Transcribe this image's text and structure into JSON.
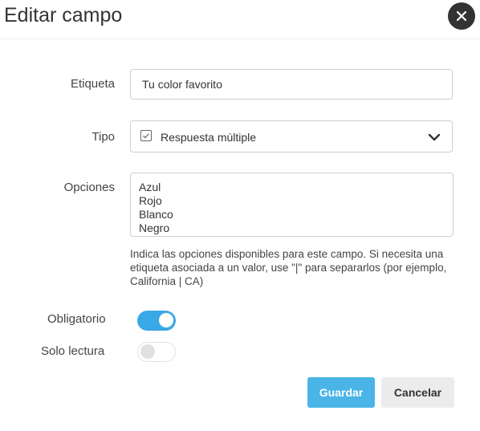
{
  "dialog": {
    "title": "Editar campo",
    "close_icon": "close-icon"
  },
  "form": {
    "etiqueta": {
      "label": "Etiqueta",
      "value": "Tu color favorito"
    },
    "tipo": {
      "label": "Tipo",
      "value": "Respuesta múltiple",
      "icon": "checkbox-icon",
      "dropdown_icon": "chevron-down-icon"
    },
    "opciones": {
      "label": "Opciones",
      "value": "Azul\nRojo\nBlanco\nNegro",
      "help": "Indica las opciones disponibles para este campo. Si necesita una etiqueta asociada a un valor, use \"|\" para separarlos (por ejemplo, California | CA)"
    },
    "obligatorio": {
      "label": "Obligatorio",
      "checked": true
    },
    "solo_lectura": {
      "label": "Solo lectura",
      "checked": false
    }
  },
  "actions": {
    "save": "Guardar",
    "cancel": "Cancelar"
  },
  "colors": {
    "accent": "#3aa8e6",
    "primary_button": "#4ab4e6",
    "secondary_button": "#ececec",
    "close_button": "#333333"
  }
}
